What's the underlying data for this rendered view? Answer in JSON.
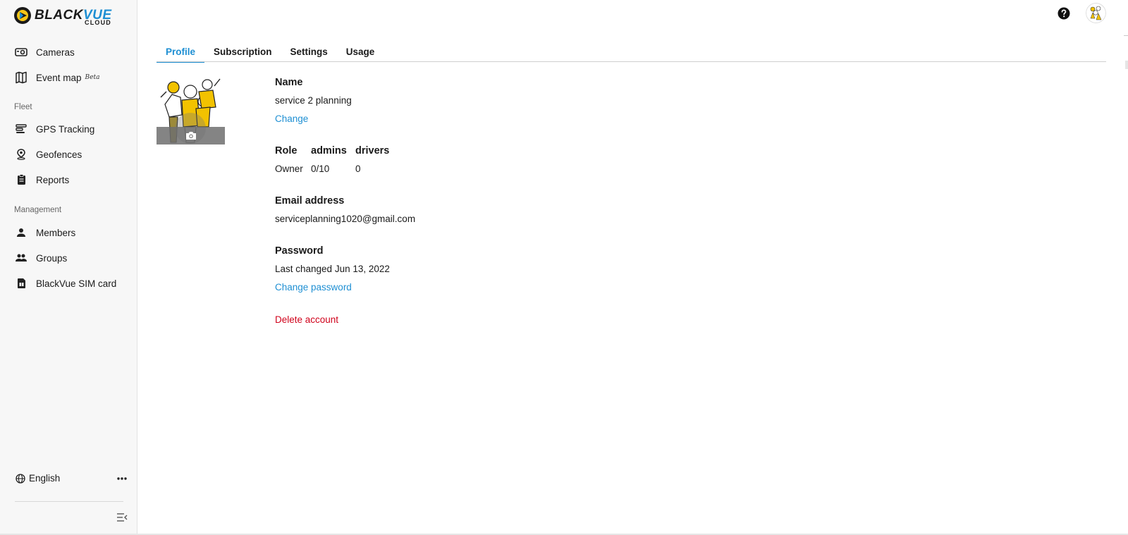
{
  "brand": {
    "word_black": "BLACK",
    "word_blue": "VUE",
    "sub": "CLOUD"
  },
  "sidebar": {
    "items": [
      {
        "label": "Cameras",
        "icon": "camera-icon"
      },
      {
        "label": "Event map",
        "badge": "Beta",
        "icon": "map-icon"
      }
    ],
    "sections": [
      {
        "label": "Fleet",
        "items": [
          {
            "label": "GPS Tracking",
            "icon": "gps-tracking-icon"
          },
          {
            "label": "Geofences",
            "icon": "geofence-pin-icon"
          },
          {
            "label": "Reports",
            "icon": "clipboard-icon"
          }
        ]
      },
      {
        "label": "Management",
        "items": [
          {
            "label": "Members",
            "icon": "person-icon"
          },
          {
            "label": "Groups",
            "icon": "group-icon"
          },
          {
            "label": "BlackVue SIM card",
            "icon": "sim-card-icon"
          }
        ]
      }
    ],
    "language": "English"
  },
  "tabs": [
    {
      "label": "Profile",
      "active": true
    },
    {
      "label": "Subscription",
      "active": false
    },
    {
      "label": "Settings",
      "active": false
    },
    {
      "label": "Usage",
      "active": false
    }
  ],
  "profile": {
    "name_label": "Name",
    "name_value": "service 2 planning",
    "change_link": "Change",
    "role_headers": [
      "Role",
      "admins",
      "drivers"
    ],
    "role_values": [
      "Owner",
      "0/10",
      "0"
    ],
    "email_label": "Email address",
    "email_value": "serviceplanning1020@gmail.com",
    "password_label": "Password",
    "password_value": "Last changed Jun 13, 2022",
    "change_password_link": "Change password",
    "delete_account": "Delete account"
  },
  "colors": {
    "accent": "#1e8fd3",
    "danger": "#d0021b",
    "sidebar_bg": "#f7f7f7"
  }
}
